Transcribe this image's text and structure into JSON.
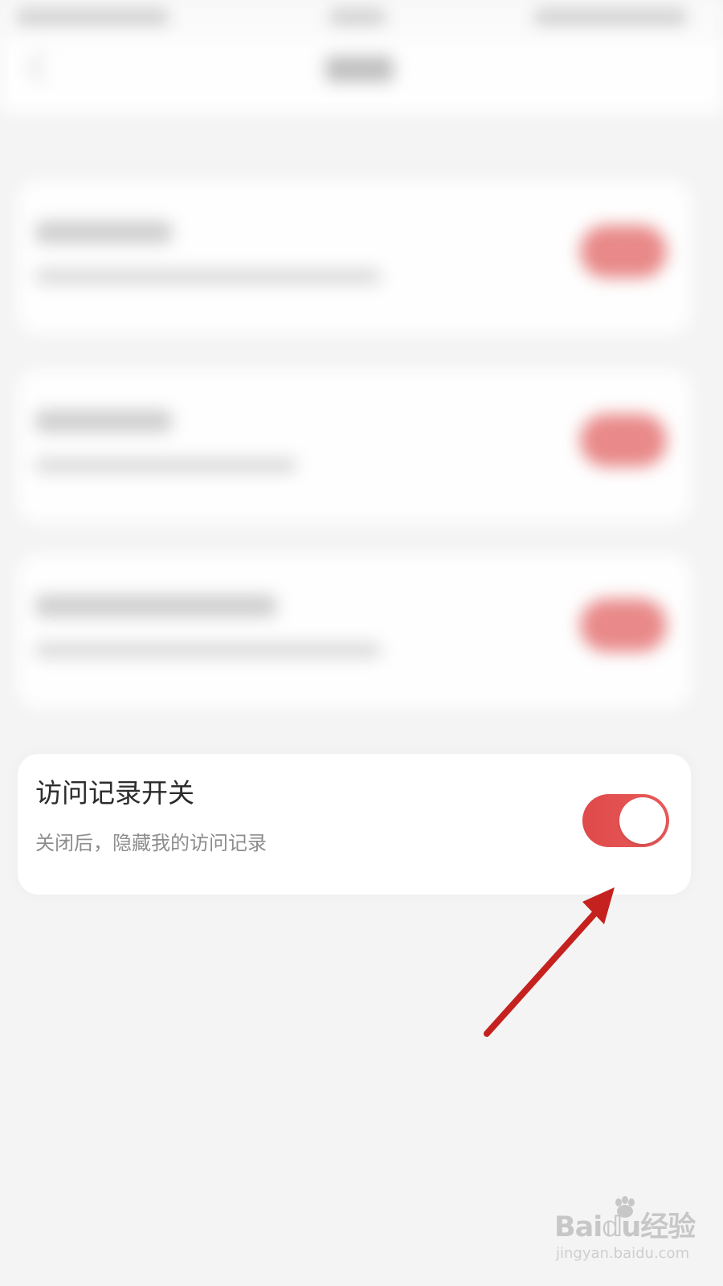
{
  "setting": {
    "title": "访问记录开关",
    "subtitle": "关闭后，隐藏我的访问记录",
    "enabled": true
  },
  "colors": {
    "toggle_on": "#e24d4d",
    "arrow": "#c5221f",
    "card": "#ffffff",
    "background": "#f4f4f4"
  },
  "watermark": {
    "logo": "Bai𝕕u经验",
    "url": "jingyan.baidu.com"
  },
  "icons": {
    "arrow": "pointer-arrow-icon",
    "watermark": "baidu-paw-icon"
  }
}
